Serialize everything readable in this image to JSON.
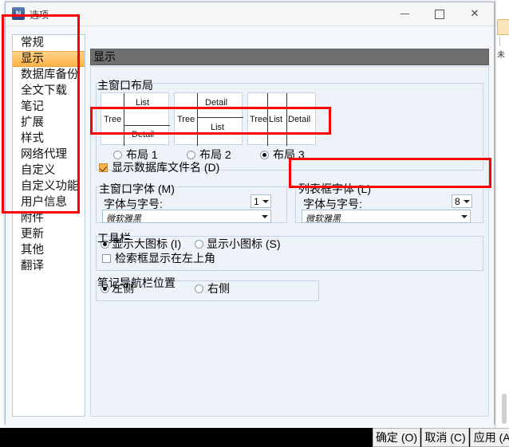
{
  "window": {
    "title": "选项",
    "icon": "app-icon",
    "minimize_label": "—",
    "maximize_label": "□",
    "close_label": "✕"
  },
  "sidebar": {
    "items": [
      {
        "label": "常规",
        "selected": false
      },
      {
        "label": "显示",
        "selected": true
      },
      {
        "label": "数据库备份",
        "selected": false
      },
      {
        "label": "全文下载",
        "selected": false
      },
      {
        "label": "笔记",
        "selected": false
      },
      {
        "label": "扩展",
        "selected": false
      },
      {
        "label": "样式",
        "selected": false
      },
      {
        "label": "网络代理",
        "selected": false
      },
      {
        "label": "自定义",
        "selected": false
      },
      {
        "label": "自定义功能",
        "selected": false
      },
      {
        "label": "用户信息",
        "selected": false
      },
      {
        "label": "附件",
        "selected": false
      },
      {
        "label": "更新",
        "selected": false
      },
      {
        "label": "其他",
        "selected": false
      },
      {
        "label": "翻译",
        "selected": false
      }
    ]
  },
  "panel": {
    "header": "显示",
    "layout_group": {
      "title": "主窗口布局",
      "thumbnails": [
        {
          "name": "布局 1",
          "regions": [
            "Tree",
            "List",
            "Detail"
          ]
        },
        {
          "name": "布局 2",
          "regions": [
            "Tree",
            "Detail",
            "List"
          ]
        },
        {
          "name": "布局 3",
          "regions": [
            "Tree",
            "List",
            "Detail"
          ]
        }
      ],
      "options": [
        {
          "label": "布局 1",
          "selected": false
        },
        {
          "label": "布局 2",
          "selected": false
        },
        {
          "label": "布局 3",
          "selected": true
        }
      ],
      "show_db_filename": {
        "label": "显示数据库文件名 (D)",
        "checked": true
      }
    },
    "main_font_group": {
      "title": "主窗口字体 (M)",
      "field_label": "字体与字号:",
      "font_value": "微软雅黑",
      "size_value": "1"
    },
    "list_font_group": {
      "title": "列表框字体 (L)",
      "field_label": "字体与字号:",
      "font_value": "微软雅黑",
      "size_value": "8"
    },
    "toolbar_group": {
      "title": "工具栏",
      "options": [
        {
          "label": "显示大图标 (I)",
          "selected": true
        },
        {
          "label": "显示小图标 (S)",
          "selected": false
        }
      ],
      "search_box_topleft": {
        "label": "检索框显示在左上角",
        "checked": false
      }
    },
    "note_nav_group": {
      "title": "笔记导航栏位置",
      "options": [
        {
          "label": "左侧",
          "selected": true
        },
        {
          "label": "右侧",
          "selected": false
        }
      ]
    }
  },
  "buttons": {
    "ok": "确定 (O)",
    "cancel": "取消 (C)",
    "apply": "应用 (A)"
  },
  "background": {
    "side_text": "未"
  },
  "colors": {
    "accent": "#ffb347",
    "annotation": "#ff0000",
    "header_bar": "#6f6f6f",
    "panel_bg": "#eef3fa"
  }
}
